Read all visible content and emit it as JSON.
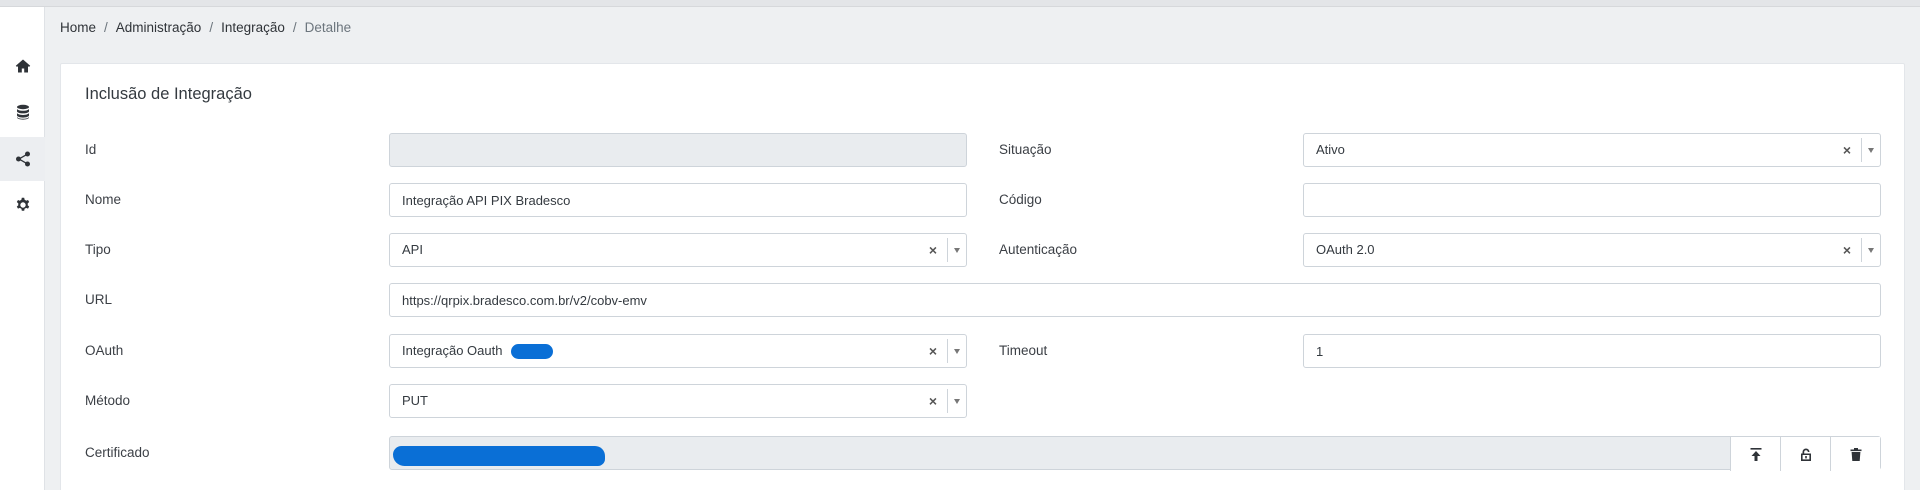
{
  "breadcrumb": {
    "items": [
      "Home",
      "Administração",
      "Integração"
    ],
    "current": "Detalhe",
    "separator": "/"
  },
  "sidebar": {
    "items": [
      {
        "icon": "home-icon"
      },
      {
        "icon": "database-icon"
      },
      {
        "icon": "share-icon",
        "active": true
      },
      {
        "icon": "gear-icon"
      }
    ]
  },
  "form": {
    "title": "Inclusão de Integração",
    "id": {
      "label": "Id",
      "value": ""
    },
    "situacao": {
      "label": "Situação",
      "value": "Ativo"
    },
    "nome": {
      "label": "Nome",
      "value": "Integração API PIX Bradesco"
    },
    "codigo": {
      "label": "Código",
      "value": ""
    },
    "tipo": {
      "label": "Tipo",
      "value": "API"
    },
    "autenticacao": {
      "label": "Autenticação",
      "value": "OAuth 2.0"
    },
    "url": {
      "label": "URL",
      "value": "https://qrpix.bradesco.com.br/v2/cobv-emv"
    },
    "oauth": {
      "label": "OAuth",
      "value": "Integração Oauth"
    },
    "timeout": {
      "label": "Timeout",
      "value": "1"
    },
    "metodo": {
      "label": "Método",
      "value": "PUT"
    },
    "certificado": {
      "label": "Certificado",
      "value": ""
    },
    "clear_glyph": "×"
  },
  "colors": {
    "redaction": "#0a6fd6",
    "readonly_bg": "#e9ecef",
    "border": "#ced4da"
  }
}
